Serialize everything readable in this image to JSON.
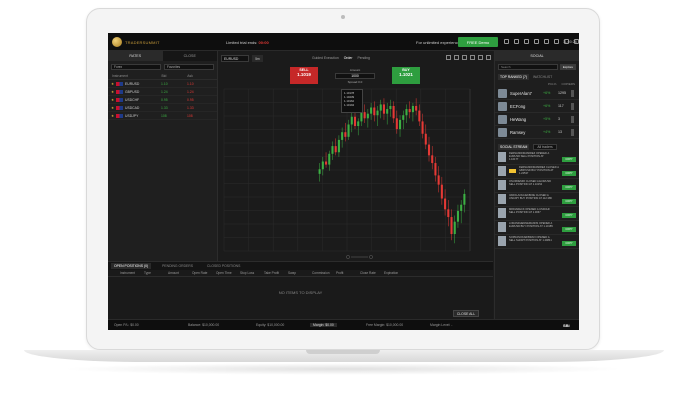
{
  "topbar": {
    "brand": "TRADERSUMMIT",
    "trial_prefix": "Limited trial ends:",
    "trial_time": "00:00",
    "unlimited_text": "For unlimited experience",
    "free_demo_label": "FREE Demo",
    "clock": "11:00:26"
  },
  "watchlist": {
    "tabs": [
      "RATES",
      "CLOSE"
    ],
    "filters": [
      "Forex",
      "Favorites"
    ],
    "columns": [
      "Instrument",
      "Bid",
      "Ask"
    ],
    "rows": [
      {
        "name": "EURUSD",
        "bid": "1.10",
        "ask": "1.10"
      },
      {
        "name": "GBPUSD",
        "bid": "1.24",
        "ask": "1.24"
      },
      {
        "name": "USDCHF",
        "bid": "0.95",
        "ask": "0.95"
      },
      {
        "name": "USDCAD",
        "bid": "1.33",
        "ask": "1.33"
      },
      {
        "name": "USDJPY",
        "bid": "108",
        "ask": "108"
      }
    ]
  },
  "chart": {
    "symbol": "EURUSD",
    "timeframe": "5m",
    "order_modes": [
      "Guided Execution",
      "Order",
      "Pending"
    ],
    "active_order_mode": "Order",
    "sell_label": "SELL",
    "sell_price": "1.1019",
    "buy_label": "BUY",
    "buy_price": "1.1021",
    "amount_label": "Amount",
    "amount_value": "1000",
    "spread_text": "Spread 0.0",
    "ohlc": [
      "1.10178",
      "1.10239",
      "1.10162",
      "1.10194"
    ]
  },
  "positions": {
    "tabs": [
      "OPEN POSITIONS (0)",
      "PENDING ORDERS",
      "CLOSED POSITIONS"
    ],
    "columns": [
      "Instrument",
      "Type",
      "Amount",
      "Open Rate",
      "Open Time",
      "Stop Loss",
      "Take Profit",
      "Swap",
      "Commission",
      "Profit",
      "Close Rate",
      "Expiration"
    ],
    "empty_text": "NO ITEMS TO DISPLAY",
    "close_all_label": "CLOSE ALL"
  },
  "social": {
    "tabs": [
      "SOCIAL"
    ],
    "search_placeholder": "Search",
    "explore_label": "Explore",
    "top_ranked_label": "TOP RANKED (7)",
    "watchlist_label": "WATCHLIST",
    "rank_columns": [
      "PCL%",
      "COPIERS"
    ],
    "traders": [
      {
        "name": "SuperAlan7",
        "pct": "+6%",
        "copiers": "1295"
      },
      {
        "name": "ECFong",
        "pct": "+6%",
        "copiers": "117"
      },
      {
        "name": "HeWang",
        "pct": "+5%",
        "copiers": "3"
      },
      {
        "name": "Ramsey",
        "pct": "+4%",
        "copiers": "13"
      }
    ],
    "stream_label": "SOCIAL STREAM",
    "stream_filter": "All traders",
    "posts": [
      {
        "text": "FERNANDORAMIREZ OPENED A EURUSD SELL POSITION AT 1.10177",
        "logo": false
      },
      {
        "text": "FERNANDORAMIREZ CLOSED A GBP/USD BUY POSITION AT 1.22537",
        "logo": true
      },
      {
        "text": "ONURDEMIR CLOSED A EUR/USD SELL POSITION AT 1.10154",
        "logo": false
      },
      {
        "text": "VAROLAOULIEKBOIE CLOSED A USDJPY BUY POSITION AT 112.386",
        "logo": false
      },
      {
        "text": "MRDIARECK OPENED A USDCHF SELL POSITION AT 1.0067",
        "logo": false
      },
      {
        "text": "LORANDHENNEMANNS OPENED A EURUSD BUY POSITION AT 1.10185",
        "logo": false
      },
      {
        "text": "SOPRANOKARIBRAVI OPENED A SELL SHORT POSITION AT 1.29841",
        "logo": false
      }
    ],
    "copy_label": "COPY"
  },
  "footer": {
    "open_pl": "Open P/L: $0.00",
    "balance": "Balance: $10,000.00",
    "equity": "Equity: $10,000.00",
    "margin": "Margin: $0.00",
    "free_margin": "Free Margin: $10,000.00",
    "margin_level": "Margin Level: -",
    "brand": "SBi"
  },
  "colors": {
    "up": "#3cb043",
    "down": "#e53935",
    "accent": "#2e9e3f"
  },
  "chart_data": {
    "type": "candlestick",
    "ohlc": [
      [
        1.0995,
        1.1002,
        1.099,
        1.0998
      ],
      [
        1.0998,
        1.1006,
        1.0994,
        1.1003
      ],
      [
        1.1003,
        1.1009,
        1.0999,
        1.1001
      ],
      [
        1.1001,
        1.101,
        1.0997,
        1.1008
      ],
      [
        1.1008,
        1.1016,
        1.1004,
        1.1013
      ],
      [
        1.1013,
        1.1018,
        1.1007,
        1.1009
      ],
      [
        1.1009,
        1.102,
        1.1006,
        1.1017
      ],
      [
        1.1017,
        1.1025,
        1.1012,
        1.1022
      ],
      [
        1.1022,
        1.1028,
        1.1016,
        1.1019
      ],
      [
        1.1019,
        1.103,
        1.1017,
        1.1027
      ],
      [
        1.1027,
        1.1035,
        1.1022,
        1.1032
      ],
      [
        1.1032,
        1.1036,
        1.1024,
        1.1026
      ],
      [
        1.1026,
        1.1031,
        1.102,
        1.1029
      ],
      [
        1.1029,
        1.1038,
        1.1026,
        1.1035
      ],
      [
        1.1035,
        1.104,
        1.1028,
        1.1031
      ],
      [
        1.1031,
        1.1037,
        1.1025,
        1.1034
      ],
      [
        1.1034,
        1.1041,
        1.103,
        1.1038
      ],
      [
        1.1038,
        1.1042,
        1.1029,
        1.1033
      ],
      [
        1.1033,
        1.1039,
        1.1026,
        1.1036
      ],
      [
        1.1036,
        1.1043,
        1.1031,
        1.104
      ],
      [
        1.104,
        1.1044,
        1.103,
        1.1034
      ],
      [
        1.1034,
        1.1041,
        1.1027,
        1.1037
      ],
      [
        1.1037,
        1.1043,
        1.1032,
        1.1039
      ],
      [
        1.1039,
        1.1042,
        1.1028,
        1.1031
      ],
      [
        1.1031,
        1.1036,
        1.1021,
        1.1024
      ],
      [
        1.1024,
        1.1033,
        1.1019,
        1.103
      ],
      [
        1.103,
        1.1036,
        1.1024,
        1.1033
      ],
      [
        1.1033,
        1.104,
        1.1028,
        1.1037
      ],
      [
        1.1037,
        1.1042,
        1.1031,
        1.1035
      ],
      [
        1.1035,
        1.1041,
        1.1029,
        1.1039
      ],
      [
        1.1039,
        1.1044,
        1.1033,
        1.1036
      ],
      [
        1.1036,
        1.104,
        1.1026,
        1.1029
      ],
      [
        1.1029,
        1.1034,
        1.1018,
        1.1021
      ],
      [
        1.1021,
        1.1027,
        1.1011,
        1.1014
      ],
      [
        1.1014,
        1.1019,
        1.1003,
        1.1007
      ],
      [
        1.1007,
        1.1013,
        1.0998,
        1.1002
      ],
      [
        1.1002,
        1.1006,
        1.099,
        1.0994
      ],
      [
        1.0994,
        1.1,
        1.0983,
        1.0988
      ],
      [
        1.0988,
        1.0993,
        1.0975,
        1.0979
      ],
      [
        1.0979,
        1.0985,
        1.0968,
        1.0972
      ],
      [
        1.0972,
        1.0978,
        1.0961,
        1.0967
      ],
      [
        1.0967,
        1.0972,
        1.0952,
        1.0956
      ],
      [
        1.0956,
        1.0968,
        1.095,
        1.0964
      ],
      [
        1.0964,
        1.0975,
        1.096,
        1.0971
      ],
      [
        1.0971,
        1.0978,
        1.0963,
        1.0975
      ],
      [
        1.0975,
        1.0985,
        1.097,
        1.0982
      ]
    ],
    "ylim": [
      1.0945,
      1.105
    ],
    "grid": true
  }
}
